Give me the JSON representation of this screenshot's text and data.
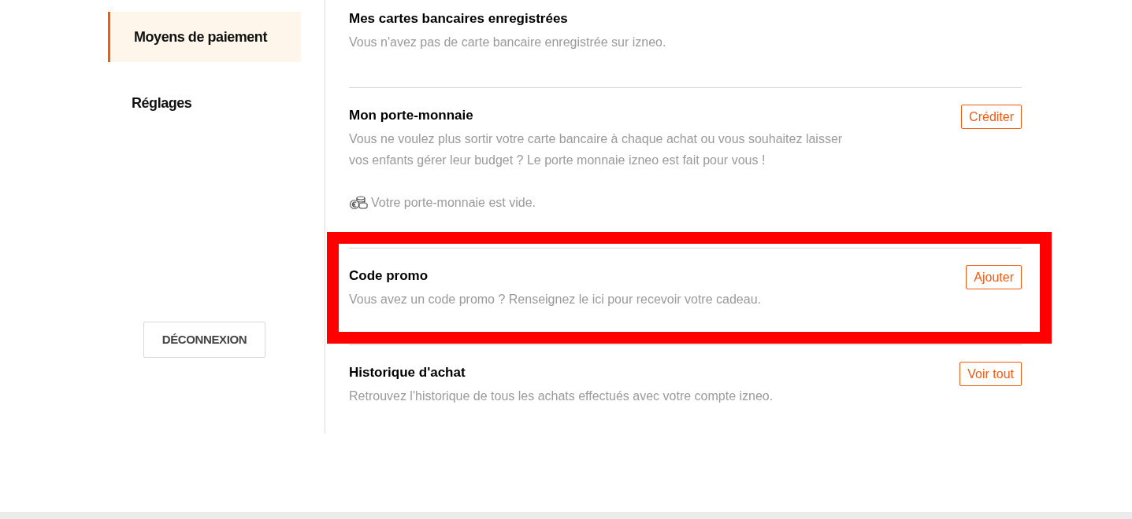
{
  "sidebar": {
    "items": [
      {
        "label": "Moyens de paiement",
        "selected": true
      },
      {
        "label": "Réglages",
        "selected": false
      }
    ],
    "logout_button": "DÉCONNEXION"
  },
  "sections": [
    {
      "title": "Mes cartes bancaires enregistrées",
      "description": "Vous n'avez pas de carte bancaire enregistrée sur izneo.",
      "highlighted": false
    },
    {
      "title": "Mon porte-monnaie",
      "description": "Vous ne voulez plus sortir votre carte bancaire à chaque achat ou vous souhaitez laisser vos enfants gérer leur budget ? Le porte monnaie izneo est fait pour vous !",
      "button": "Créditer",
      "note": "Votre porte-monnaie est vide.",
      "highlighted": false
    },
    {
      "title": "Code promo",
      "description": "Vous avez un code promo ? Renseignez le ici pour recevoir votre cadeau.",
      "button": "Ajouter",
      "highlighted": true
    },
    {
      "title": "Historique d'achat",
      "description": "Retrouvez l'historique de tous les achats effectués avec votre compte izneo.",
      "button": "Voir tout",
      "highlighted": false
    }
  ]
}
